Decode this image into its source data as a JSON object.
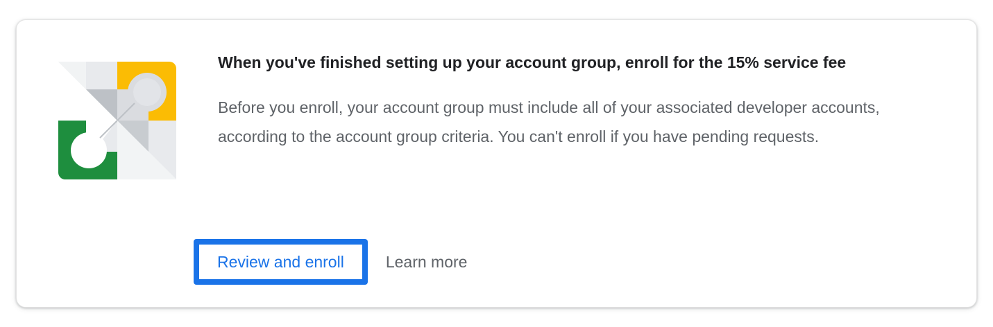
{
  "card": {
    "title": "When you've finished setting up your account group, enroll for the 15% service fee",
    "body": "Before you enroll, your account group must include all of your associated developer accounts, according to the account group criteria. You can't enroll if you have pending requests.",
    "illustration_icon": "account-group-illustration-icon",
    "actions": {
      "primary_label": "Review and enroll",
      "secondary_label": "Learn more"
    }
  },
  "colors": {
    "accent_blue": "#1a73e8",
    "focus_ring": "#1a73e8",
    "illustration_yellow": "#fbbc04",
    "illustration_green": "#1e8e3e",
    "illustration_gray_light": "#e8eaed",
    "illustration_gray_mid": "#bdc1c6"
  }
}
